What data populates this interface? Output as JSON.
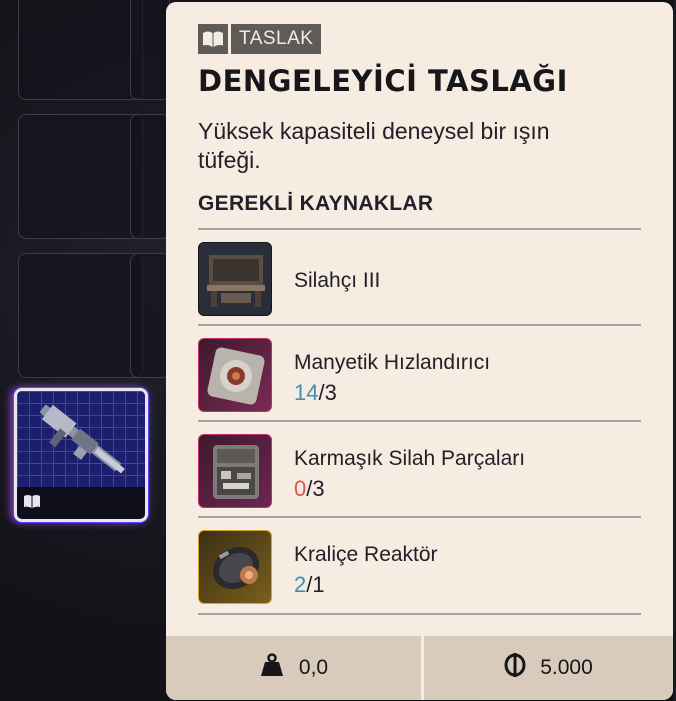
{
  "inventory": {
    "selected_item_badge_icon": "book-icon"
  },
  "panel": {
    "tag": {
      "icon": "book-icon",
      "label": "TASLAK"
    },
    "title": "DENGELEYİCİ TASLAĞI",
    "description": "Yüksek kapasiteli deneysel bir ışın tüfeği.",
    "section_title": "GEREKLİ KAYNAKLAR",
    "resources": [
      {
        "name": "Silahçı III",
        "icon": "workbench-icon",
        "rarity_color": "#2a2e38"
      },
      {
        "name": "Manyetik Hızlandırıcı",
        "have": "14",
        "need": "/3",
        "have_color": "#3f8fb3",
        "icon": "magnetic-accelerator-icon",
        "rarity_color": "#c0306e"
      },
      {
        "name": "Karmaşık Silah Parçaları",
        "have": "0",
        "need": "/3",
        "have_color": "#e0574a",
        "icon": "weapon-parts-icon",
        "rarity_color": "#c0306e"
      },
      {
        "name": "Kraliçe Reaktör",
        "have": "2",
        "need": "/1",
        "have_color": "#3f8fb3",
        "icon": "queen-reactor-icon",
        "rarity_color": "#d8a42a"
      }
    ],
    "footer": {
      "weight_icon": "weight-icon",
      "weight": "0,0",
      "price_icon": "coin-icon",
      "price": "5.000"
    }
  }
}
